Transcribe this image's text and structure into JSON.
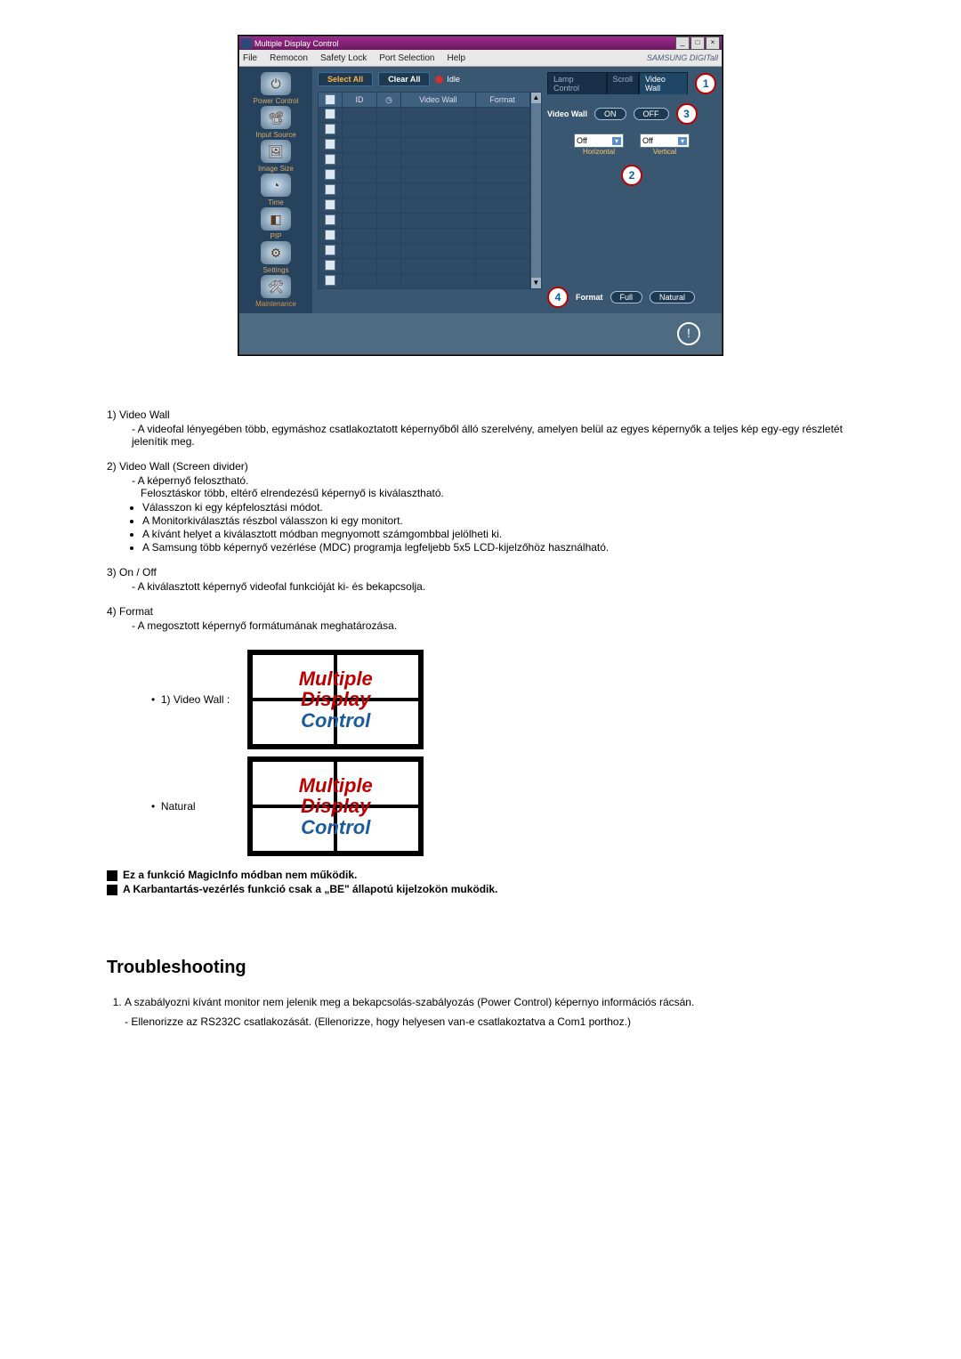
{
  "app": {
    "title": "Multiple Display Control",
    "brand": "SAMSUNG DIGITall",
    "menu": [
      "File",
      "Remocon",
      "Safety Lock",
      "Port Selection",
      "Help"
    ],
    "sidebar": [
      {
        "label": "Power Control"
      },
      {
        "label": "Input Source"
      },
      {
        "label": "Image Size"
      },
      {
        "label": "Time"
      },
      {
        "label": "PIP"
      },
      {
        "label": "Settings"
      },
      {
        "label": "Maintenance"
      }
    ],
    "toolbar": {
      "select_all": "Select All",
      "clear_all": "Clear All",
      "idle": "Idle"
    },
    "grid": {
      "headers": {
        "id": "ID",
        "videowall": "Video Wall",
        "format": "Format"
      }
    },
    "tabs": {
      "lamp": "Lamp Control",
      "scroll": "Scroll",
      "videowall": "Video Wall"
    },
    "right": {
      "videowall_label": "Video Wall",
      "on": "ON",
      "off": "OFF",
      "h_sel": "Off",
      "h_label": "Horizontal",
      "v_sel": "Off",
      "v_label": "Vertical",
      "format_label": "Format",
      "full": "Full",
      "natural": "Natural"
    },
    "callouts": {
      "c1": "1",
      "c2": "2",
      "c3": "3",
      "c4": "4"
    }
  },
  "doc": {
    "s1_title": "1)  Video Wall",
    "s1_p1": "- A videofal lényegében több, egymáshoz csatlakoztatott képernyőből álló szerelvény, amelyen belül az egyes képernyők a teljes kép egy-egy részletét jelenítik meg.",
    "s2_title": "2)  Video Wall (Screen divider)",
    "s2_p1": "- A képernyő felosztható.",
    "s2_p2": "Felosztáskor több, eltérő elrendezésű képernyő is kiválasztható.",
    "s2_b1": "Válasszon ki egy képfelosztási módot.",
    "s2_b2": "A Monitorkiválasztás részbol válasszon ki egy monitort.",
    "s2_b3": "A kívánt helyet a kiválasztott módban megnyomott számgombbal jelölheti ki.",
    "s2_b4": "A Samsung több képernyő vezérlése (MDC) programja legfeljebb 5x5 LCD-kijelzőhöz használható.",
    "s3_title": "3)  On / Off",
    "s3_p1": "- A kiválasztott képernyő videofal funkcióját ki- és bekapcsolja.",
    "s4_title": "4)  Format",
    "s4_p1": "- A megosztott képernyő formátumának meghatározása.",
    "fig1_label": "1) Video Wall :",
    "fig2_label": "Natural",
    "fig_l1": "Multiple",
    "fig_l2": "Display",
    "fig_l3": "Control",
    "note1": "Ez a funkció MagicInfo módban nem működik.",
    "note2": "A Karbantartás-vezérlés funkció csak a „BE\" állapotú kijelzokön muködik.",
    "ts_title": "Troubleshooting",
    "ts1": "A szabályozni kívánt monitor nem jelenik meg a bekapcsolás-szabályozás (Power Control) képernyo információs rácsán.",
    "ts1_p1": "- Ellenorizze az RS232C csatlakozását. (Ellenorizze, hogy helyesen van-e csatlakoztatva a Com1 porthoz.)"
  }
}
